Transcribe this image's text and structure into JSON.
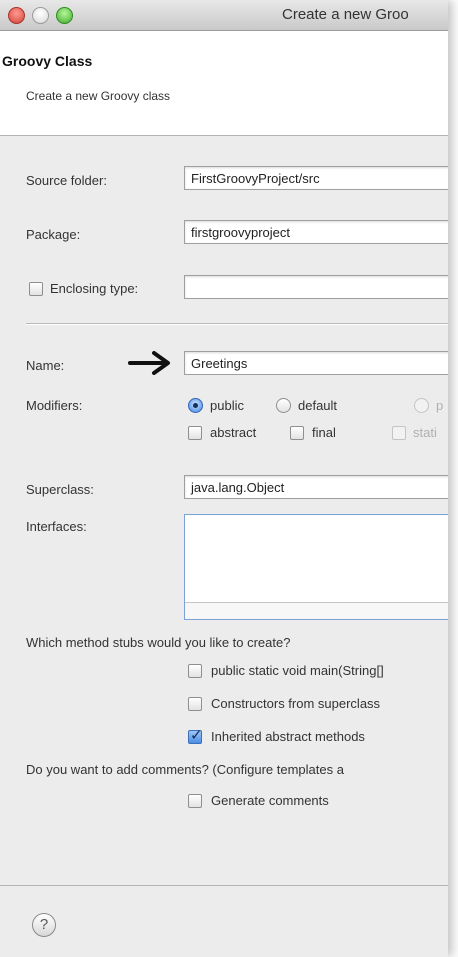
{
  "window": {
    "title": "Create a new Groo"
  },
  "header": {
    "title": "Groovy Class",
    "description": "Create a new Groovy class"
  },
  "form": {
    "source_folder": {
      "label": "Source folder:",
      "value": "FirstGroovyProject/src"
    },
    "package": {
      "label": "Package:",
      "value": "firstgroovyproject"
    },
    "enclosing_type": {
      "label": "Enclosing type:",
      "value": ""
    },
    "name": {
      "label": "Name:",
      "value": "Greetings"
    },
    "modifiers": {
      "label": "Modifiers:",
      "radios": [
        "public",
        "default",
        "p"
      ],
      "selected": "public",
      "checks": [
        "abstract",
        "final",
        "stati"
      ]
    },
    "superclass": {
      "label": "Superclass:",
      "value": "java.lang.Object"
    },
    "interfaces": {
      "label": "Interfaces:"
    },
    "stubs": {
      "question": "Which method stubs would you like to create?",
      "options": [
        {
          "label": "public static void main(String[]",
          "checked": false
        },
        {
          "label": "Constructors from superclass",
          "checked": false
        },
        {
          "label": "Inherited abstract methods",
          "checked": true
        }
      ]
    },
    "comments": {
      "question": "Do you want to add comments? (Configure templates a",
      "option": {
        "label": "Generate comments",
        "checked": false
      }
    }
  },
  "footer": {
    "help_glyph": "?"
  },
  "colors": {
    "accent": "#3f84e6",
    "close": "#d2433a",
    "zoom": "#3fae2c"
  },
  "icons": [
    "close-icon",
    "minimize-icon",
    "zoom-icon",
    "arrow-right-icon",
    "help-icon",
    "checkmark-icon"
  ]
}
